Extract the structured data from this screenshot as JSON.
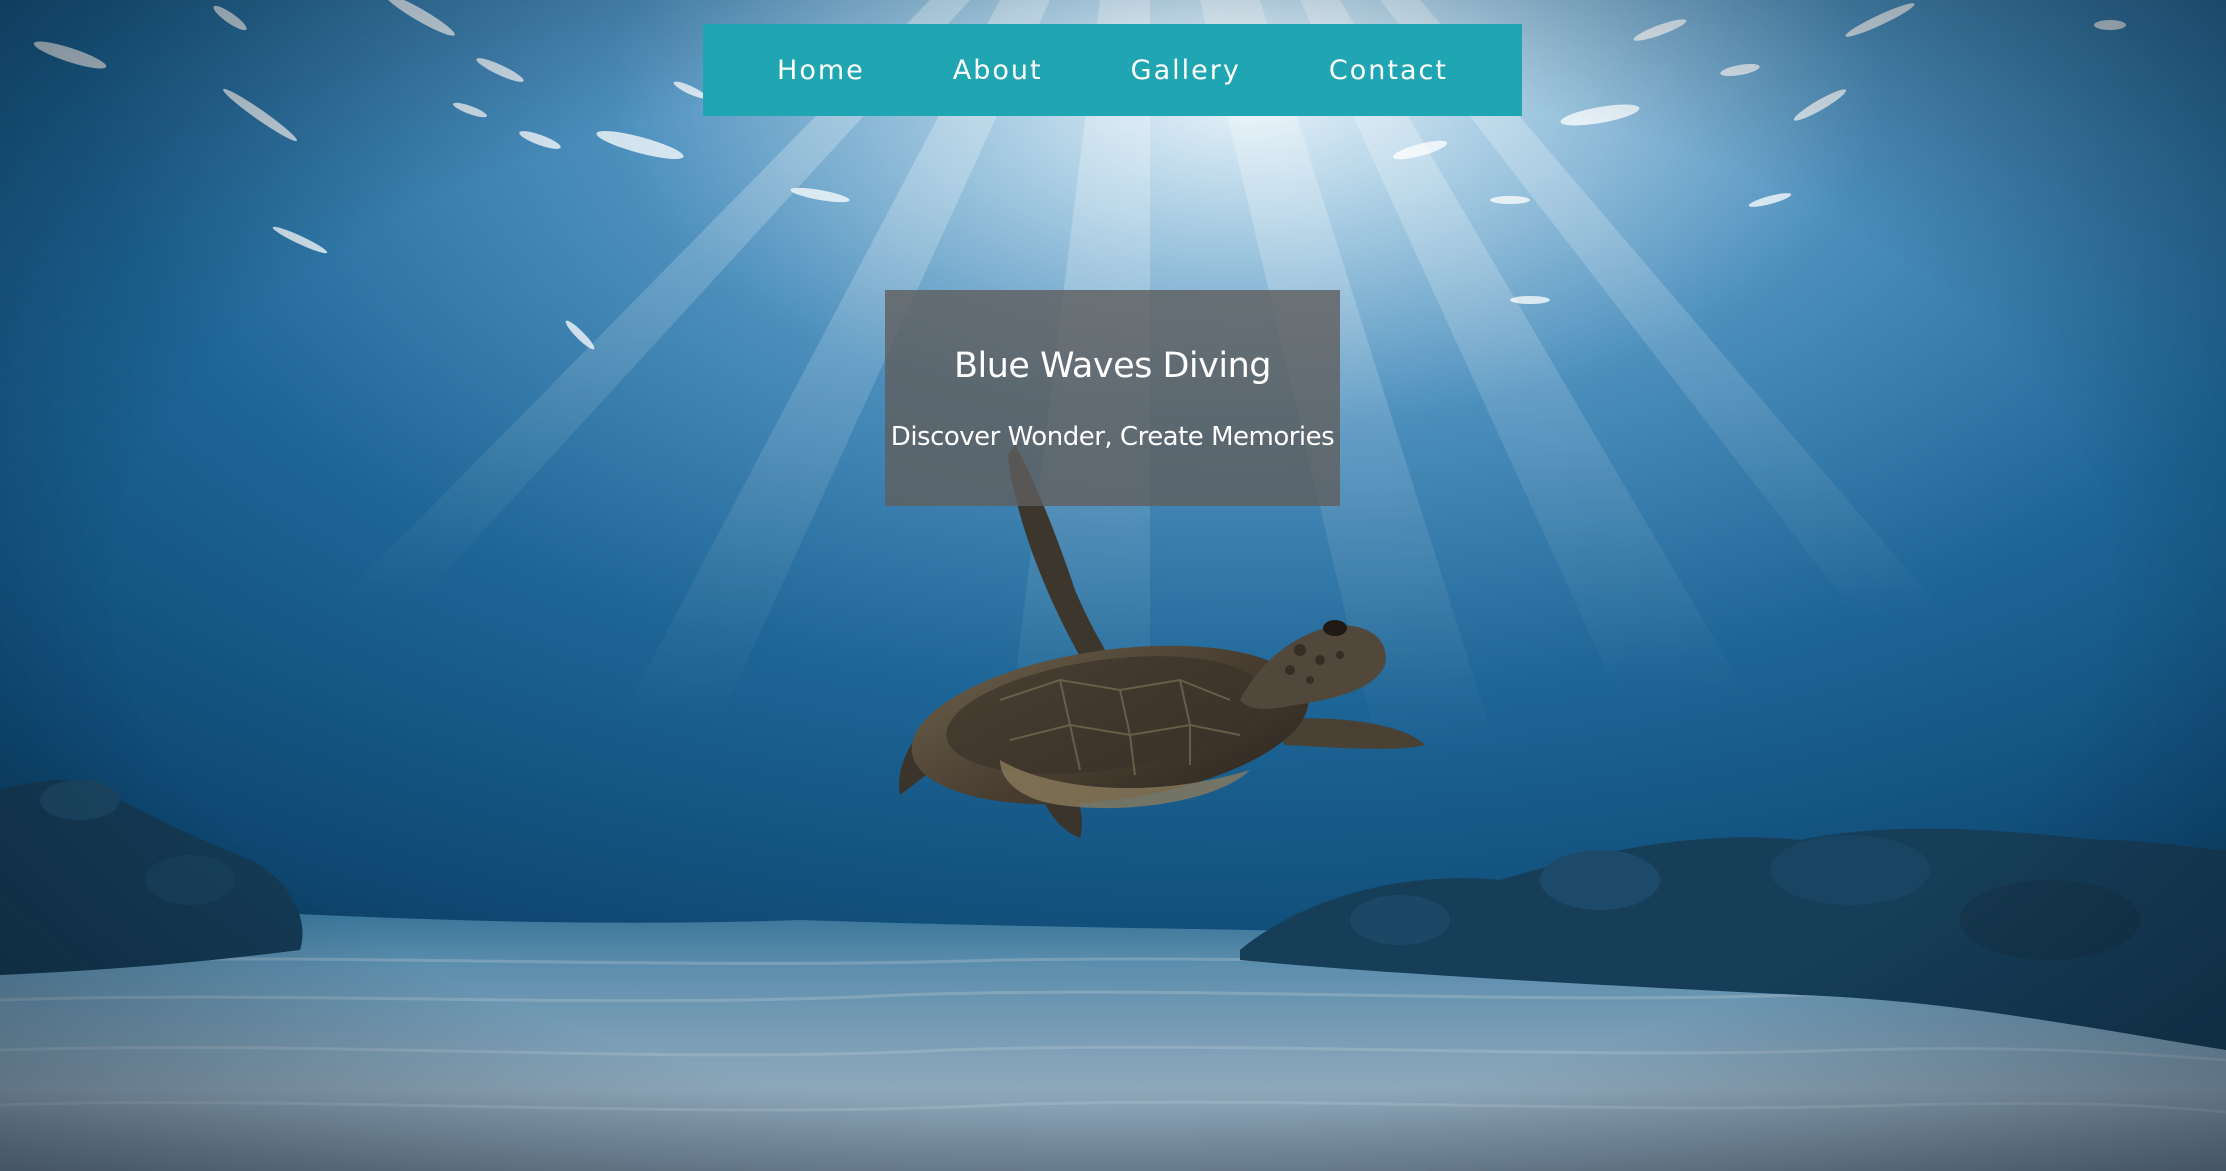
{
  "nav": {
    "items": [
      {
        "label": "Home"
      },
      {
        "label": "About"
      },
      {
        "label": "Gallery"
      },
      {
        "label": "Contact"
      }
    ]
  },
  "hero": {
    "title": "Blue Waves Diving",
    "subtitle": "Discover Wonder, Create Memories"
  },
  "colors": {
    "nav_background": "#20a6b3",
    "hero_box_background": "#5f5f5f",
    "text": "#ffffff",
    "ocean_deep": "#0d3e62"
  },
  "background_image": {
    "subject": "sea-turtle-underwater",
    "icon": "sea-turtle-icon"
  }
}
